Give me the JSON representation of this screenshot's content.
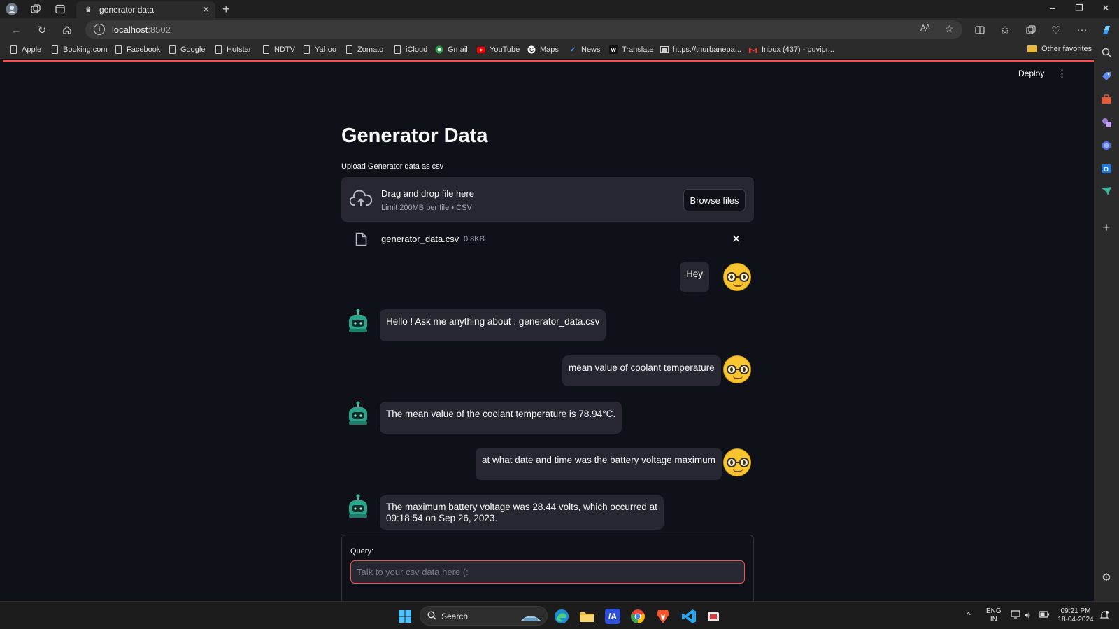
{
  "browser": {
    "tab_title": "generator data",
    "url_host": "localhost",
    "url_port": ":8502",
    "bookmarks": [
      "Apple",
      "Booking.com",
      "Facebook",
      "Google",
      "Hotstar",
      "NDTV",
      "Yahoo",
      "Zomato",
      "iCloud",
      "Gmail",
      "YouTube",
      "Maps",
      "News",
      "Translate",
      "https://tnurbanepa...",
      "Inbox (437) - puvipr..."
    ],
    "other_favorites": "Other favorites"
  },
  "app": {
    "deploy_label": "Deploy",
    "title": "Generator Data",
    "uploader": {
      "label": "Upload Generator data as csv",
      "drop_text": "Drag and drop file here",
      "limit_text": "Limit 200MB per file • CSV",
      "browse_label": "Browse files"
    },
    "file": {
      "name": "generator_data.csv",
      "size": "0.8KB"
    },
    "messages": [
      {
        "role": "user",
        "text": "Hey"
      },
      {
        "role": "assistant",
        "text": "Hello ! Ask me anything about : generator_data.csv"
      },
      {
        "role": "user",
        "text": "mean value of coolant temperature"
      },
      {
        "role": "assistant",
        "text": "The mean value of the coolant temperature is 78.94°C."
      },
      {
        "role": "user",
        "text": "at what date and time was the battery voltage maximum"
      },
      {
        "role": "assistant",
        "text": "The maximum battery voltage was 28.44 volts, which occurred at",
        "text2": "09:18:54 on Sep 26, 2023."
      }
    ],
    "query": {
      "label": "Query:",
      "placeholder": "Talk to your csv data here (:"
    }
  },
  "taskbar": {
    "search_label": "Search",
    "lang_line1": "ENG",
    "lang_line2": "IN",
    "time": "09:21 PM",
    "date": "18-04-2024"
  },
  "colors": {
    "accent": "#ff4b4b",
    "background": "#0e1117",
    "bubble": "#262730"
  }
}
